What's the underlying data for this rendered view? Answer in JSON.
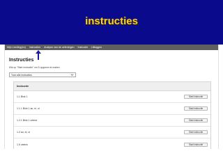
{
  "slide": {
    "title": "instructies"
  },
  "navbar": {
    "items": [
      "Mijn Leerling(en)",
      "Instructies",
      "Analyse van de oefeningen",
      "Instructie",
      "Uitloggen"
    ]
  },
  "page": {
    "heading": "Instructies",
    "subtitle": "Klik op \"Start instructie\" om 5 opgaven te maken.",
    "filter": {
      "selected": "Toon alle instructies"
    }
  },
  "table": {
    "header": "Instructie",
    "button_label": "Start instructie",
    "rows": [
      "1.1 Blok 1",
      "1.1.1 Blok 1 au, ei, ui",
      "1.2.1 Blok 1 cetera",
      "1.3 au, ei, ui",
      "1.5 cetera"
    ]
  },
  "colors": {
    "slide_background": "#0a0a8c",
    "slide_title": "#ffd21a",
    "navbar": "#5f5f5f",
    "pointer_arrow": "#1a1aa0"
  }
}
